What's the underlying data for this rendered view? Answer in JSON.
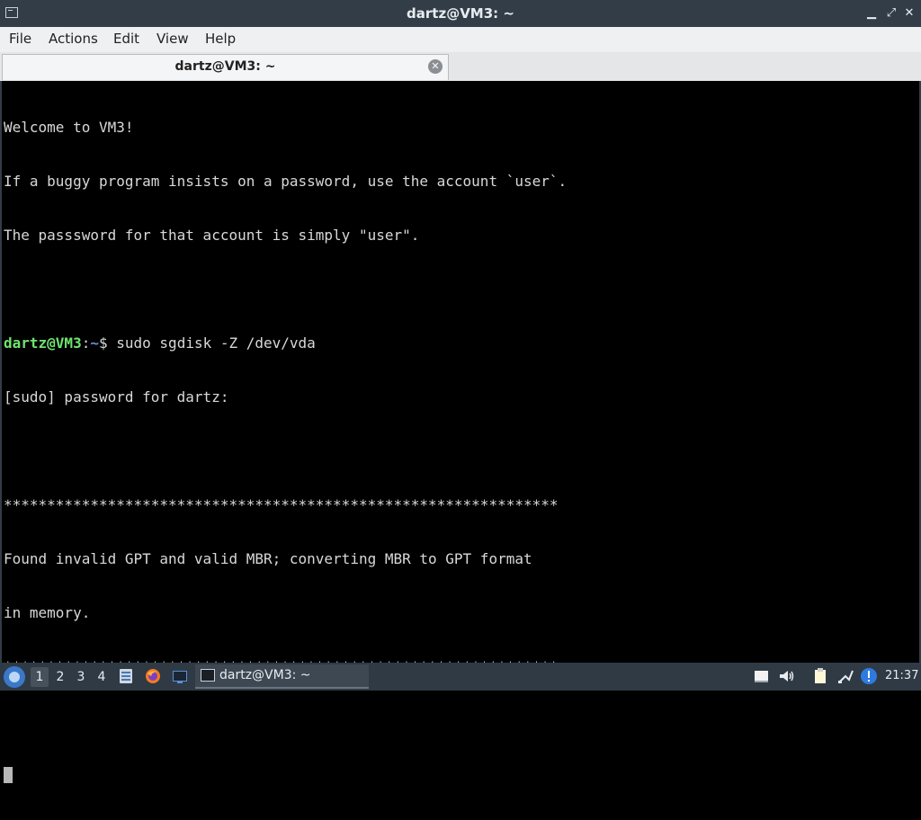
{
  "window": {
    "title": "dartz@VM3: ~",
    "controls": [
      "minimize-icon",
      "maximize-icon",
      "close-icon"
    ]
  },
  "menu": {
    "items": [
      "File",
      "Actions",
      "Edit",
      "View",
      "Help"
    ]
  },
  "tab": {
    "label": "dartz@VM3: ~"
  },
  "terminal": {
    "lines": [
      "Welcome to VM3!",
      "If a buggy program insists on a password, use the account `user`.",
      "The passsword for that account is simply \"user\".",
      "",
      "",
      "[sudo] password for dartz:",
      "",
      "****************************************************************",
      "Found invalid GPT and valid MBR; converting MBR to GPT format",
      "in memory.",
      "****************************************************************"
    ],
    "prompt": {
      "user_host": "dartz@VM3",
      "sep": ":",
      "path": "~",
      "symbol": "$",
      "command": " sudo sgdisk -Z /dev/vda"
    }
  },
  "taskbar": {
    "desktops": [
      "1",
      "2",
      "3",
      "4"
    ],
    "active_desktop": "1",
    "launchers": [
      "file-manager-icon",
      "firefox-icon",
      "terminal-launcher-icon"
    ],
    "task_label": "dartz@VM3: ~",
    "tray_icons": [
      "clipboard-icon",
      "volume-icon",
      "notes-icon",
      "network-icon",
      "update-notifier-icon"
    ],
    "clock": "21:37"
  }
}
